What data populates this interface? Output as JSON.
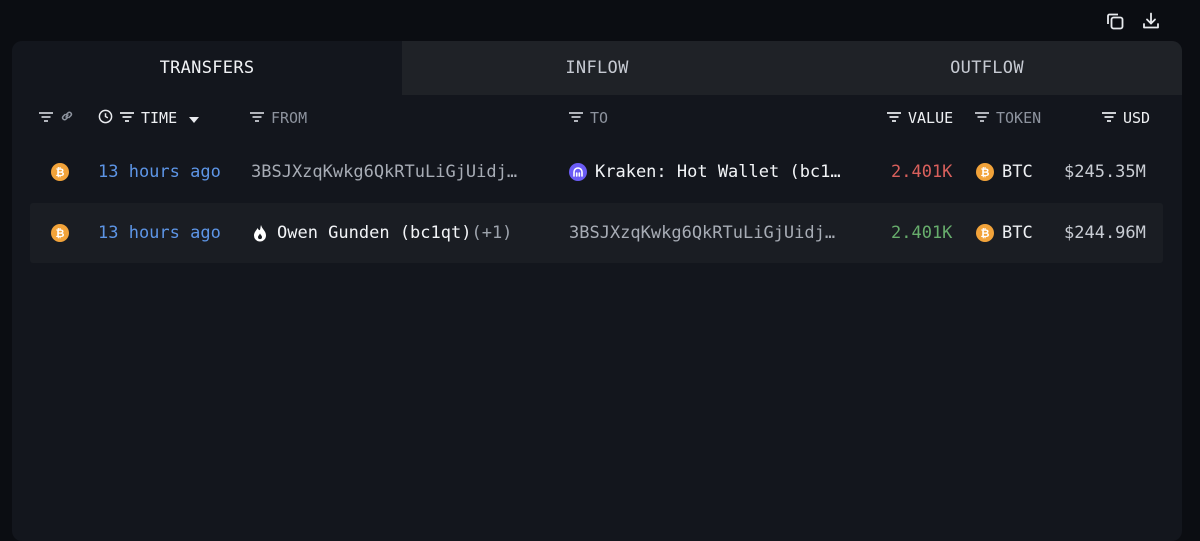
{
  "toolbar": {
    "copy_icon": "copy-icon",
    "download_icon": "download-icon"
  },
  "tabs": [
    {
      "label": "TRANSFERS",
      "active": true
    },
    {
      "label": "INFLOW",
      "active": false
    },
    {
      "label": "OUTFLOW",
      "active": false
    }
  ],
  "columns": {
    "time": "TIME",
    "from": "FROM",
    "to": "TO",
    "value": "VALUE",
    "token": "TOKEN",
    "usd": "USD"
  },
  "rows": [
    {
      "time": "13 hours ago",
      "from": "3BSJXzqKwkg6QkRTuLiGjUidj…",
      "to": "Kraken: Hot Wallet (bc1…",
      "value": "2.401K",
      "value_direction": "out",
      "token": "BTC",
      "usd": "$245.35M"
    },
    {
      "time": "13 hours ago",
      "from": "Owen Gunden (bc1qt)",
      "from_extra": "(+1)",
      "to": "3BSJXzqKwkg6QkRTuLiGjUidj…",
      "value": "2.401K",
      "value_direction": "in",
      "token": "BTC",
      "usd": "$244.96M"
    }
  ],
  "colors": {
    "time": "#5d95e6",
    "value_out": "#d9605c",
    "value_in": "#67ad6c",
    "btc": "#f2a33a",
    "kraken": "#6b5cf6"
  }
}
